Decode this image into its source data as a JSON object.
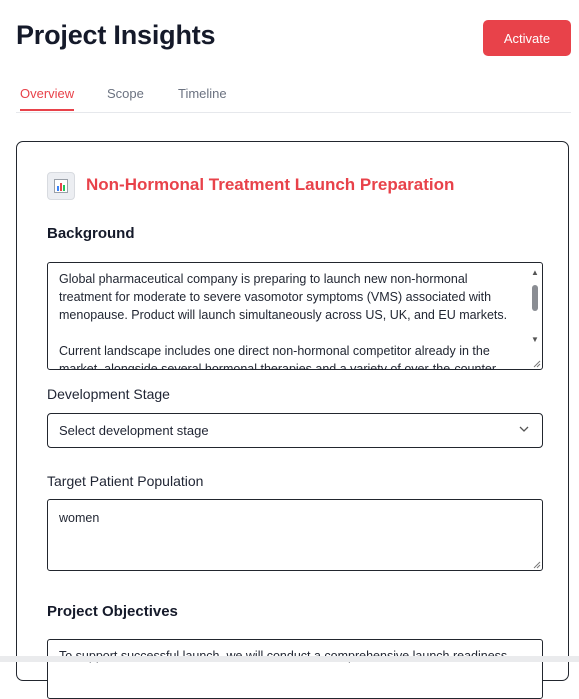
{
  "header": {
    "title": "Project Insights",
    "activate_label": "Activate"
  },
  "tabs": [
    {
      "label": "Overview",
      "active": true
    },
    {
      "label": "Scope",
      "active": false
    },
    {
      "label": "Timeline",
      "active": false
    }
  ],
  "project": {
    "icon": "bar-chart-icon",
    "name": "Non-Hormonal Treatment Launch Preparation"
  },
  "background": {
    "heading": "Background",
    "text": "Global pharmaceutical company is preparing to launch new non-hormonal treatment for moderate to severe vasomotor symptoms (VMS) associated with menopause. Product will launch simultaneously across US, UK, and EU markets.\n\nCurrent landscape includes one direct non-hormonal competitor already in the market, alongside several hormonal therapies and a variety of over-the-counter"
  },
  "development_stage": {
    "label": "Development Stage",
    "selected": "Select development stage"
  },
  "target_population": {
    "label": "Target Patient Population",
    "value": "women"
  },
  "objectives": {
    "heading": "Project Objectives",
    "text": "To support successful launch, we will conduct a comprehensive launch readiness"
  },
  "colors": {
    "accent": "#e8424a",
    "title": "#151a2a",
    "border": "#22262e"
  }
}
